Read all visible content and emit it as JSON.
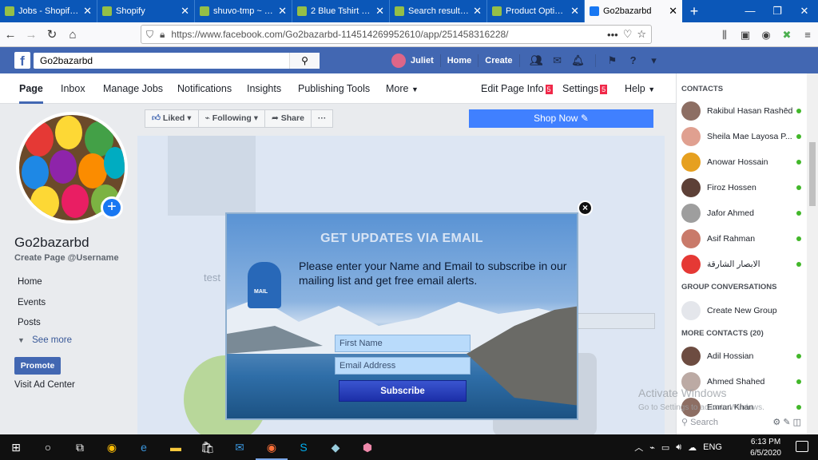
{
  "browser": {
    "tabs": [
      {
        "label": "Jobs - Shopify Pa",
        "color": "#95bf47"
      },
      {
        "label": "Shopify",
        "color": "#95bf47"
      },
      {
        "label": "shuvo-tmp ~ The",
        "color": "#95bf47"
      },
      {
        "label": "2 Blue Tshirt – shuvo",
        "color": "#95bf47"
      },
      {
        "label": "Search results for",
        "color": "#95bf47"
      },
      {
        "label": "Product Options",
        "color": "#95bf47"
      },
      {
        "label": "Go2bazarbd",
        "color": "#1877f2"
      }
    ],
    "new_tab": "+",
    "url": "https://www.facebook.com/Go2bazarbd-114514269952610/app/251458316228/",
    "url_host": "facebook.com"
  },
  "fb_bar": {
    "search_value": "Go2bazarbd",
    "user": "Juliet",
    "home": "Home",
    "create": "Create"
  },
  "page_nav": {
    "items": [
      "Page",
      "Inbox",
      "Manage Jobs",
      "Notifications",
      "Insights",
      "Publishing Tools",
      "More"
    ],
    "edit_info": "Edit Page Info",
    "edit_badge": "5",
    "settings": "Settings",
    "settings_badge": "5",
    "help": "Help"
  },
  "left": {
    "page_name": "Go2bazarbd",
    "username": "Create Page @Username",
    "nav": [
      "Home",
      "Events",
      "Posts"
    ],
    "see_more": "See more",
    "promote": "Promote",
    "visit_ad": "Visit Ad Center"
  },
  "actions": {
    "liked": "Liked",
    "following": "Following",
    "share": "Share",
    "more": "···",
    "shop_now": "Shop Now"
  },
  "cover_text": "test",
  "modal": {
    "title": "GET UPDATES VIA EMAIL",
    "text": "Please enter your Name and Email to subscribe in our mailing list and get free email alerts.",
    "mailbox_label": "MAIL",
    "first_name_placeholder": "First Name",
    "email_placeholder": "Email Address",
    "subscribe": "Subscribe"
  },
  "sidebar": {
    "contacts_header": "CONTACTS",
    "contacts": [
      "Rakibul Hasan Rashēd",
      "Sheila Mae Layosa P...",
      "Anowar Hossain",
      "Firoz Hossen",
      "Jafor Ahmed",
      "Asif Rahman",
      "الابصار الشارقة"
    ],
    "group_header": "GROUP CONVERSATIONS",
    "create_group": "Create New Group",
    "more_header": "MORE CONTACTS (20)",
    "more_contacts": [
      "Adil Hossian",
      "Ahmed Shahed",
      "Emran Khan"
    ],
    "search_placeholder": "Search"
  },
  "watermark": {
    "line1": "Activate Windows",
    "line2": "Go to Settings to activate Windows."
  },
  "taskbar": {
    "time": "6:13 PM",
    "date": "6/5/2020"
  }
}
